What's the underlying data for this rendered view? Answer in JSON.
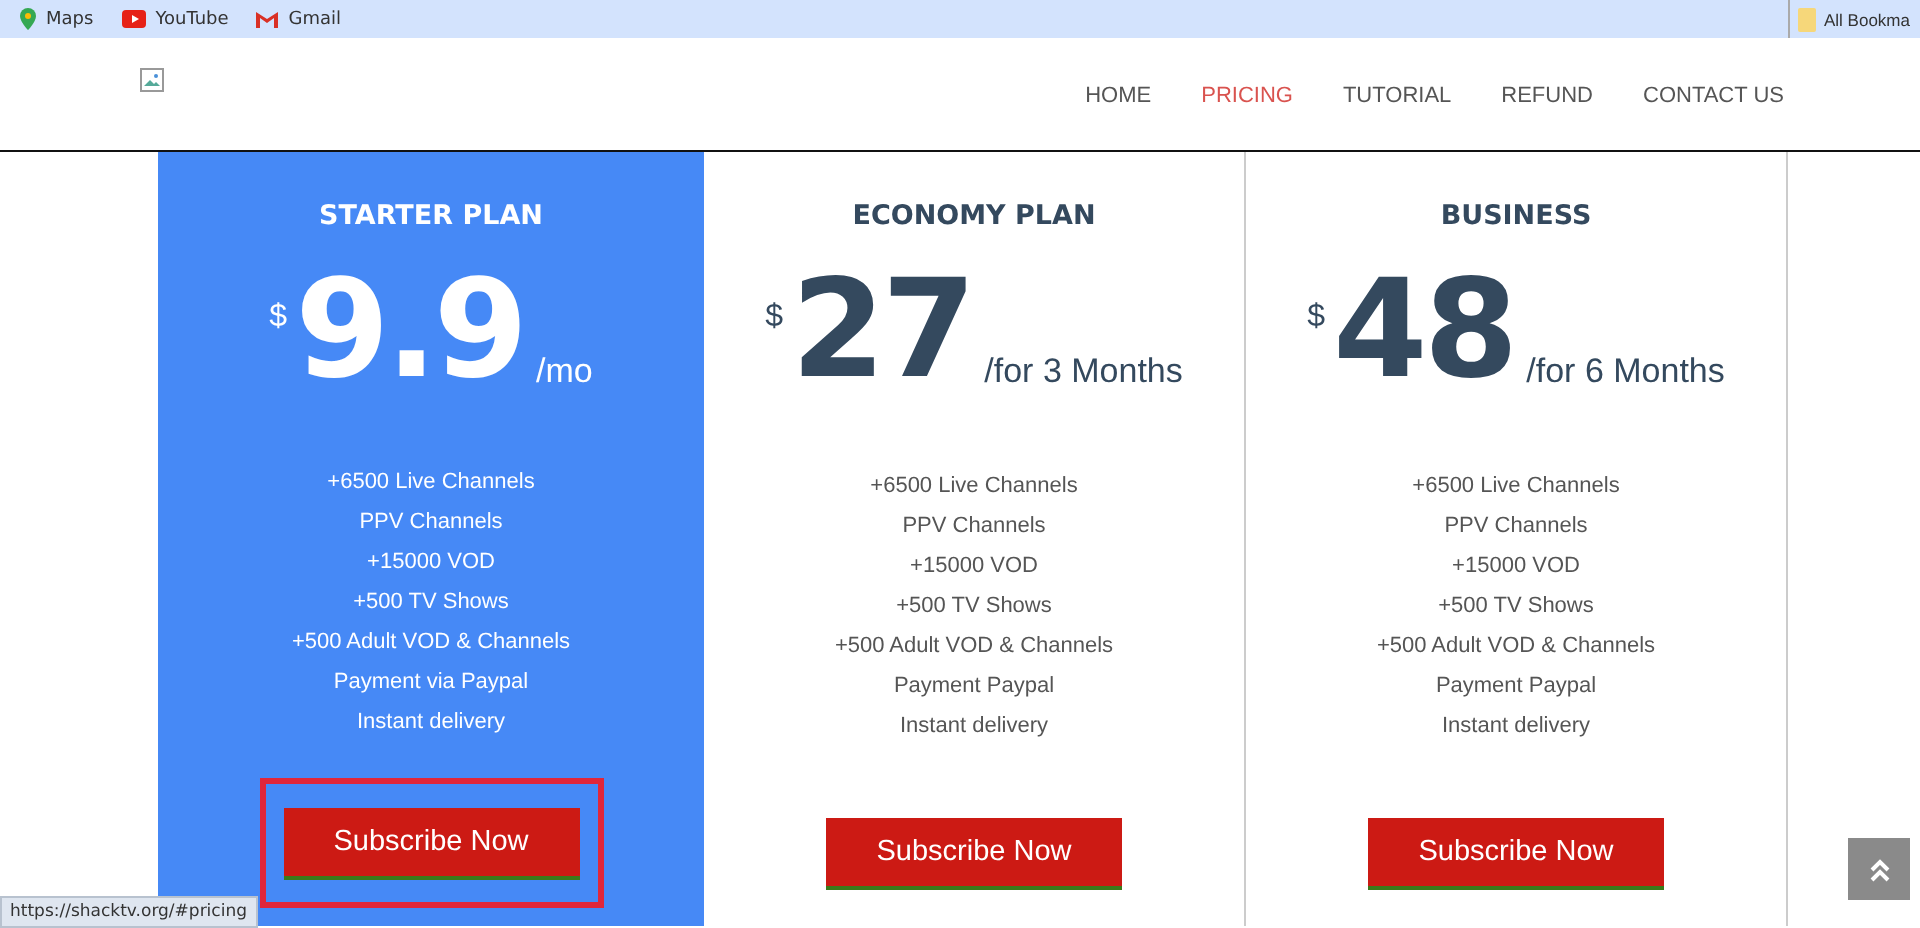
{
  "bookmarks": [
    {
      "label": "Maps",
      "kind": "maps"
    },
    {
      "label": "YouTube",
      "kind": "youtube"
    },
    {
      "label": "Gmail",
      "kind": "gmail"
    }
  ],
  "bookmarks_folder": "All Bookma",
  "nav": [
    {
      "label": "HOME",
      "selected": false
    },
    {
      "label": "PRICING",
      "selected": true
    },
    {
      "label": "TUTORIAL",
      "selected": false
    },
    {
      "label": "REFUND",
      "selected": false
    },
    {
      "label": "CONTACT US",
      "selected": false
    }
  ],
  "plans": [
    {
      "name": "STARTER PLAN",
      "currency": "$",
      "price": "9.9",
      "period": "/mo",
      "featured": true,
      "outlined": true,
      "features": [
        "+6500 Live Channels",
        "PPV Channels",
        "+15000 VOD",
        "+500 TV Shows",
        "+500 Adult VOD & Channels",
        "Payment via Paypal",
        "Instant delivery"
      ],
      "button": "Subscribe Now"
    },
    {
      "name": "ECONOMY PLAN",
      "currency": "$",
      "price": "27",
      "period": "/for 3 Months",
      "featured": false,
      "outlined": false,
      "features": [
        "+6500 Live Channels",
        "PPV Channels",
        "+15000 VOD",
        "+500 TV Shows",
        "+500 Adult VOD & Channels",
        "Payment Paypal",
        "Instant delivery"
      ],
      "button": "Subscribe Now"
    },
    {
      "name": "BUSINESS",
      "currency": "$",
      "price": "48",
      "period": "/for 6 Months",
      "featured": false,
      "outlined": false,
      "features": [
        "+6500 Live Channels",
        "PPV Channels",
        "+15000 VOD",
        "+500 TV Shows",
        "+500 Adult VOD & Channels",
        "Payment Paypal",
        "Instant delivery"
      ],
      "button": "Subscribe Now"
    }
  ],
  "status_url": "https://shacktv.org/#pricing"
}
